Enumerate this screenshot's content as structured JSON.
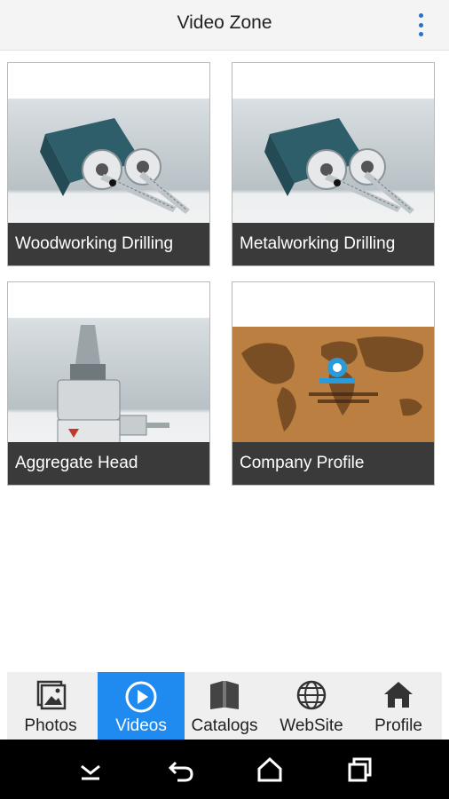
{
  "header": {
    "title": "Video Zone",
    "menu_icon": "more-vert-icon"
  },
  "tiles": [
    {
      "label": "Woodworking Drilling"
    },
    {
      "label": "Metalworking Drilling"
    },
    {
      "label": "Aggregate Head"
    },
    {
      "label": "Company Profile"
    }
  ],
  "tabs": [
    {
      "label": "Photos",
      "icon": "photos-icon",
      "active": false
    },
    {
      "label": "Videos",
      "icon": "play-circle-icon",
      "active": true
    },
    {
      "label": "Catalogs",
      "icon": "book-icon",
      "active": false
    },
    {
      "label": "WebSite",
      "icon": "globe-icon",
      "active": false
    },
    {
      "label": "Profile",
      "icon": "home-icon",
      "active": false
    }
  ],
  "colors": {
    "active_tab": "#1f8af0",
    "caption_bg": "#3a3a3a",
    "accent": "#2b6fce"
  }
}
